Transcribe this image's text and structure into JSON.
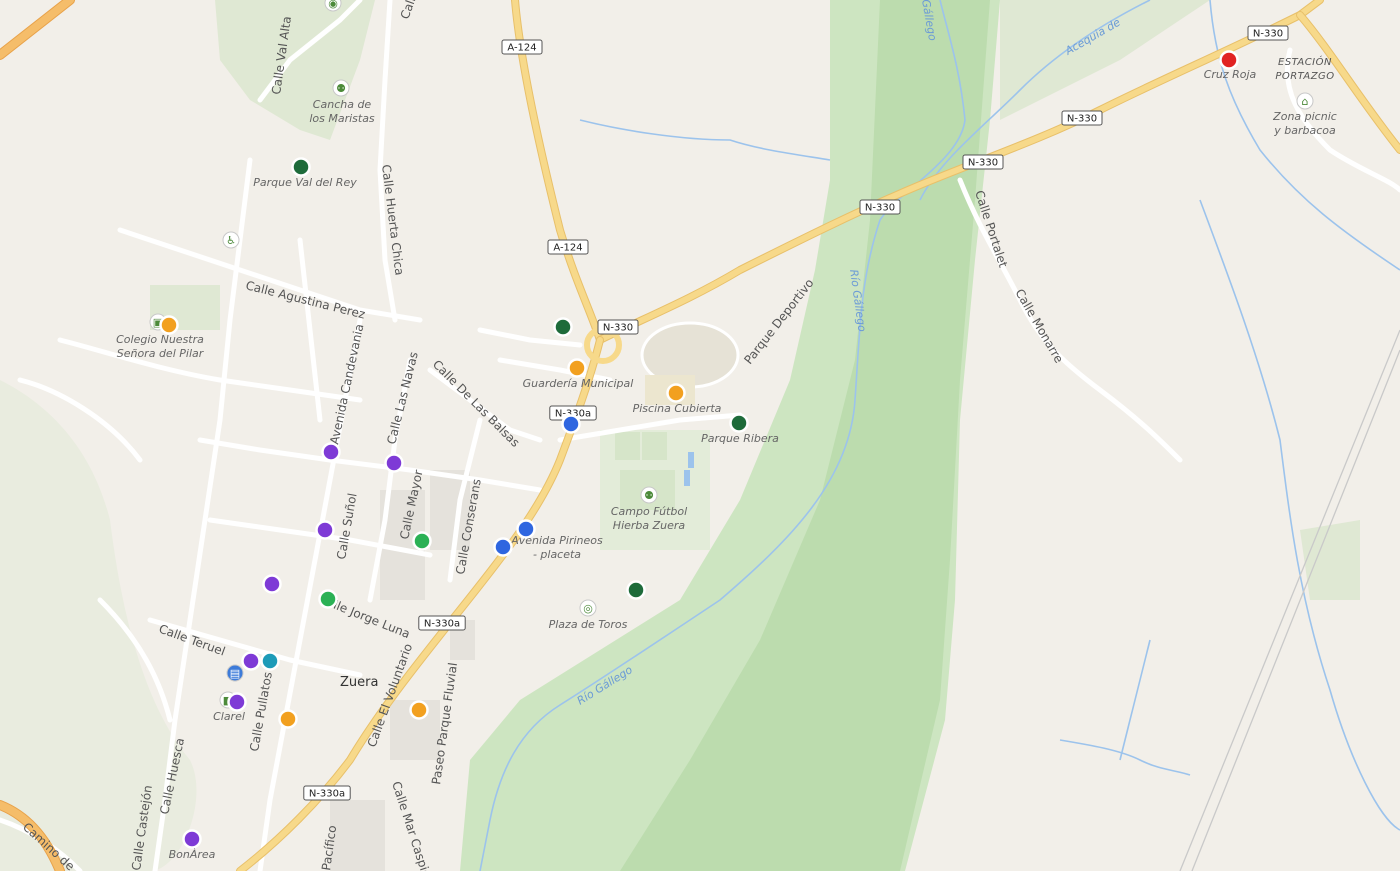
{
  "map": {
    "town_label": "Zuera",
    "colors": {
      "background": "#f2efe9",
      "park": "#cde5c1",
      "park_dark": "#bcdcae",
      "road_main": "#f7d98a",
      "road_main_casing": "#e8c06a",
      "road_minor": "#ffffff",
      "water": "#9cc3ec",
      "marker_green_dark": "#1e6b3a",
      "marker_green": "#2bb155",
      "marker_orange": "#f2a01f",
      "marker_purple": "#7e3ad6",
      "marker_blue": "#2f66e0",
      "marker_teal": "#1d9bb8",
      "marker_red": "#e12323"
    },
    "road_shields": [
      {
        "id": "a124-1",
        "text": "A-124"
      },
      {
        "id": "a124-2",
        "text": "A-124"
      },
      {
        "id": "n330-1",
        "text": "N-330"
      },
      {
        "id": "n330-2",
        "text": "N-330"
      },
      {
        "id": "n330-3",
        "text": "N-330"
      },
      {
        "id": "n330-4",
        "text": "N-330"
      },
      {
        "id": "n330-5",
        "text": "N-330"
      },
      {
        "id": "n330a-1",
        "text": "N-330a"
      },
      {
        "id": "n330a-2",
        "text": "N-330a"
      },
      {
        "id": "n330a-3",
        "text": "N-330a"
      }
    ],
    "street_labels": [
      {
        "id": "val-alta",
        "text": "Calle Val Alta"
      },
      {
        "id": "huerta-chica",
        "text": "Calle Huerta Chica"
      },
      {
        "id": "agustina",
        "text": "Calle Agustina Perez"
      },
      {
        "id": "candevania",
        "text": "Avenida Candevania"
      },
      {
        "id": "las-navas",
        "text": "Calle Las Navas"
      },
      {
        "id": "las-balsas",
        "text": "Calle De Las Balsas"
      },
      {
        "id": "sunol",
        "text": "Calle Suñol"
      },
      {
        "id": "mayor",
        "text": "Calle Mayor"
      },
      {
        "id": "conserans",
        "text": "Calle Conserans"
      },
      {
        "id": "jorge-luna",
        "text": "Calle Jorge Luna"
      },
      {
        "id": "teruel",
        "text": "Calle Teruel"
      },
      {
        "id": "pullatos",
        "text": "Calle Pullatos"
      },
      {
        "id": "huesca",
        "text": "Calle Huesca"
      },
      {
        "id": "castejon",
        "text": "Calle Castejón"
      },
      {
        "id": "camino",
        "text": "Camino de"
      },
      {
        "id": "voluntario",
        "text": "Calle El Voluntario"
      },
      {
        "id": "paseo-fluvial",
        "text": "Paseo Parque Fluvial"
      },
      {
        "id": "mar-caspio",
        "text": "Calle Mar Caspio"
      },
      {
        "id": "pacifico",
        "text": "Pacífico"
      },
      {
        "id": "parque-deportivo",
        "text": "Parque Deportivo"
      },
      {
        "id": "portalet",
        "text": "Calle Portalet"
      },
      {
        "id": "monarre",
        "text": "Calle Monarre"
      },
      {
        "id": "calle-top",
        "text": "Calle"
      }
    ],
    "water_labels": [
      {
        "id": "rio-gallego-1",
        "text": "Río Gállego"
      },
      {
        "id": "rio-gallego-2",
        "text": "Río Gállego"
      },
      {
        "id": "gallego-top",
        "text": "Gállego"
      },
      {
        "id": "acequia",
        "text": "Acequia de"
      }
    ],
    "poi_labels": [
      {
        "id": "cancha",
        "text": "Cancha de\nlos Maristas"
      },
      {
        "id": "val-del-rey",
        "text": "Parque Val del Rey"
      },
      {
        "id": "colegio",
        "text": "Colegio Nuestra\nSeñora del Pilar"
      },
      {
        "id": "guarderia",
        "text": "Guardería Municipal"
      },
      {
        "id": "piscina",
        "text": "Piscina Cubierta"
      },
      {
        "id": "ribera",
        "text": "Parque Ribera"
      },
      {
        "id": "campo",
        "text": "Campo Fútbol\nHierba Zuera"
      },
      {
        "id": "pirineos",
        "text": "Avenida Pirineos\n- placeta"
      },
      {
        "id": "toros",
        "text": "Plaza de Toros"
      },
      {
        "id": "clarel",
        "text": "Clarel"
      },
      {
        "id": "bonarea",
        "text": "BonÀrea"
      },
      {
        "id": "cruz-roja",
        "text": "Cruz Roja"
      },
      {
        "id": "estacion",
        "text": "ESTACIÓN\nPORTAZGO"
      },
      {
        "id": "picnic",
        "text": "Zona picnic\ny barbacoa"
      }
    ],
    "markers": [
      {
        "id": "m-val-del-rey",
        "category": "park",
        "color": "#1e6b3a"
      },
      {
        "id": "m-colegio",
        "category": "education",
        "color": "#f2a01f"
      },
      {
        "id": "m-n330-junction",
        "category": "park",
        "color": "#1e6b3a"
      },
      {
        "id": "m-guarderia",
        "category": "education",
        "color": "#f2a01f"
      },
      {
        "id": "m-piscina",
        "category": "education",
        "color": "#f2a01f"
      },
      {
        "id": "m-ribera",
        "category": "park",
        "color": "#1e6b3a"
      },
      {
        "id": "m-n330a",
        "category": "transport",
        "color": "#2f66e0"
      },
      {
        "id": "m-candevania",
        "category": "shop",
        "color": "#7e3ad6"
      },
      {
        "id": "m-las-navas",
        "category": "shop",
        "color": "#7e3ad6"
      },
      {
        "id": "m-sunol",
        "category": "shop",
        "color": "#7e3ad6"
      },
      {
        "id": "m-mayor",
        "category": "leisure",
        "color": "#2bb155"
      },
      {
        "id": "m-pirineos-1",
        "category": "transport",
        "color": "#2f66e0"
      },
      {
        "id": "m-pirineos-2",
        "category": "transport",
        "color": "#2f66e0"
      },
      {
        "id": "m-toros",
        "category": "park",
        "color": "#1e6b3a"
      },
      {
        "id": "m-jorge-luna-shop",
        "category": "shop",
        "color": "#7e3ad6"
      },
      {
        "id": "m-jorge-luna",
        "category": "leisure",
        "color": "#2bb155"
      },
      {
        "id": "m-teruel-1",
        "category": "shop",
        "color": "#7e3ad6"
      },
      {
        "id": "m-teruel-2",
        "category": "health",
        "color": "#1d9bb8"
      },
      {
        "id": "m-clarel",
        "category": "shop",
        "color": "#7e3ad6"
      },
      {
        "id": "m-pullatos",
        "category": "education",
        "color": "#f2a01f"
      },
      {
        "id": "m-voluntario",
        "category": "education",
        "color": "#f2a01f"
      },
      {
        "id": "m-bonarea",
        "category": "shop",
        "color": "#7e3ad6"
      },
      {
        "id": "m-cruz-roja",
        "category": "emergency",
        "color": "#e12323"
      }
    ],
    "icons": [
      {
        "id": "i-cancha",
        "name": "sports-icon"
      },
      {
        "id": "i-accessible",
        "name": "wheelchair-icon"
      },
      {
        "id": "i-school",
        "name": "school-icon"
      },
      {
        "id": "i-campo",
        "name": "sports-icon"
      },
      {
        "id": "i-toros",
        "name": "bullring-icon"
      },
      {
        "id": "i-bus",
        "name": "bus-stop-icon"
      },
      {
        "id": "i-shop",
        "name": "shop-icon"
      },
      {
        "id": "i-picnic",
        "name": "picnic-icon"
      },
      {
        "id": "i-top",
        "name": "place-icon"
      }
    ]
  }
}
